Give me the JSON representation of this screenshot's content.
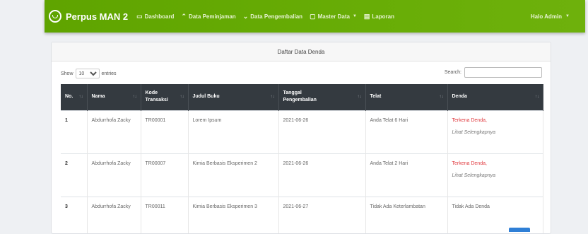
{
  "navbar": {
    "brand": "Perpus MAN 2",
    "items": [
      {
        "label": "Dashboard",
        "icon": "monitor-icon"
      },
      {
        "label": "Data Peminjaman",
        "icon": "arrow-up-icon"
      },
      {
        "label": "Data Pengembalian",
        "icon": "arrow-down-icon"
      },
      {
        "label": "Master Data",
        "icon": "folder-icon",
        "caret": true
      },
      {
        "label": "Laporan",
        "icon": "report-icon"
      }
    ],
    "user": "Halo Admin"
  },
  "card": {
    "title": "Daftar Data Denda"
  },
  "controls": {
    "show_label": "Show",
    "entries_value": "10",
    "entries_label": "entries",
    "search_label": "Search:"
  },
  "table": {
    "headers": [
      "No.",
      "Nama",
      "Kode Transaksi",
      "Judul Buku",
      "Tanggal Pengembalian",
      "Telat",
      "Denda"
    ],
    "rows": [
      {
        "no": "1",
        "nama": "Abdurrhofa Zacky",
        "kode": "TR00001",
        "judul": "Lorem Ipsum",
        "tanggal": "2021-06-26",
        "telat": "Anda Telat 6 Hari",
        "denda": "Terkena Denda,",
        "lihat": "Lihat Selengkapnya"
      },
      {
        "no": "2",
        "nama": "Abdurrhofa Zacky",
        "kode": "TR00007",
        "judul": "Kimia Berbasis Eksperimen 2",
        "tanggal": "2021-06-26",
        "telat": "Anda Telat 2 Hari",
        "denda": "Terkena Denda,",
        "lihat": "Lihat Selengkapnya"
      },
      {
        "no": "3",
        "nama": "Abdurrhofa Zacky",
        "kode": "TR00011",
        "judul": "Kimia Berbasis Eksperimen 3",
        "tanggal": "2021-06-27",
        "telat": "Tidak Ada Keterlambatan",
        "denda": "Tidak Ada Denda",
        "lihat": ""
      }
    ]
  },
  "colors": {
    "navbar": "#68ad06",
    "table_header": "#343a40",
    "denda_red": "#e0393e"
  }
}
